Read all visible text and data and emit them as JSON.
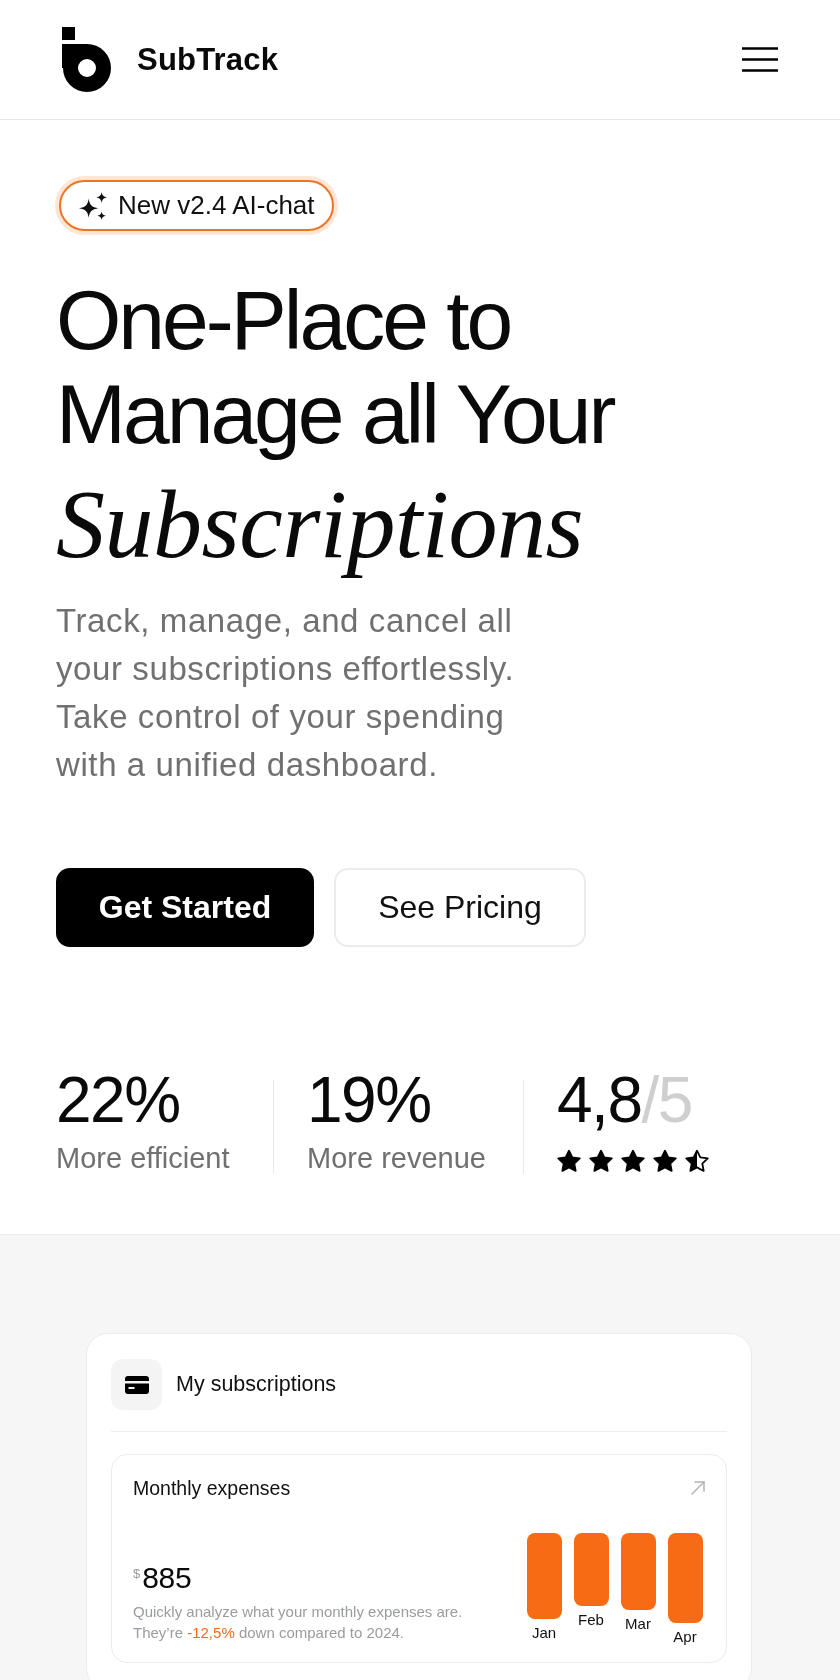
{
  "header": {
    "brand": "SubTrack"
  },
  "hero": {
    "badge": "New v2.4 AI-chat",
    "title": "One-Place to Manage all Your *Subscriptions*",
    "description": "Track, manage, and cancel all your subscriptions effortlessly. Take control of your spending with a unified dashboard.",
    "buttons": [
      {
        "label": "Get Started",
        "kind": "primary"
      },
      {
        "label": "See Pricing",
        "kind": "secondary"
      }
    ]
  },
  "stats": [
    {
      "kind": "percent",
      "value": "22%",
      "label": "More efficient"
    },
    {
      "kind": "percent",
      "value": "19%",
      "label": "More revenue"
    },
    {
      "kind": "rating",
      "value": "4,8",
      "scale": "/5",
      "stars": 4.5
    }
  ],
  "dashboard": {
    "title": "My subscriptions",
    "widget": {
      "title": "Monthly expenses",
      "currency": "$",
      "amount": "885",
      "description": "Quickly analyze what your monthly expenses are. They’re **-12,5%** down compared to 2024.",
      "months": [
        "Jan",
        "Feb",
        "Mar",
        "Apr"
      ]
    }
  }
}
